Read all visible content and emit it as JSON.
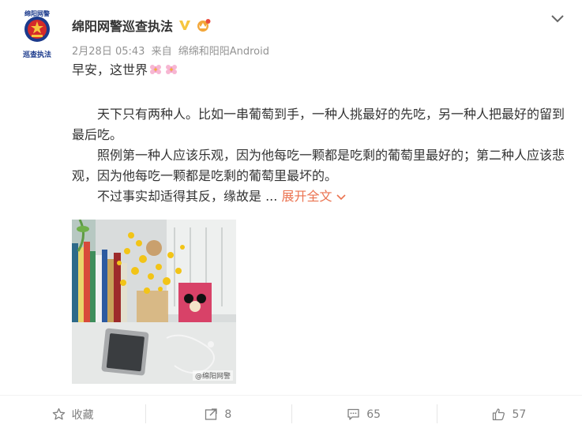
{
  "author": {
    "name": "绵阳网警巡查执法",
    "avatar_text_top": "绵阳网警",
    "avatar_text_bottom": "巡查执法",
    "verified_icon": "verified-v-icon",
    "vip_icon": "vip-crown-icon"
  },
  "meta": {
    "date": "2月28日 05:43",
    "source_prefix": "来自",
    "source": "绵绵和阳阳Android"
  },
  "post": {
    "greeting": "早安，这世界",
    "paragraph1": "天下只有两种人。比如一串葡萄到手，一种人挑最好的先吃，另一种人把最好的留到最后吃。",
    "paragraph2": "照例第一种人应该乐观，因为他每吃一颗都是吃剩的葡萄里最好的；第二种人应该悲观，因为他每吃一颗都是吃剩的葡萄里最坏的。",
    "paragraph3": "不过事实却适得其反，缘故是 ...",
    "expand_label": "展开全文",
    "photo_watermark": "@绵阳网警"
  },
  "actions": {
    "favorite_label": "收藏",
    "repost_count": "8",
    "comment_count": "65",
    "like_count": "57"
  },
  "colors": {
    "accent": "#eb7350",
    "muted": "#939393",
    "text": "#333333",
    "verified": "#f6c63f"
  }
}
